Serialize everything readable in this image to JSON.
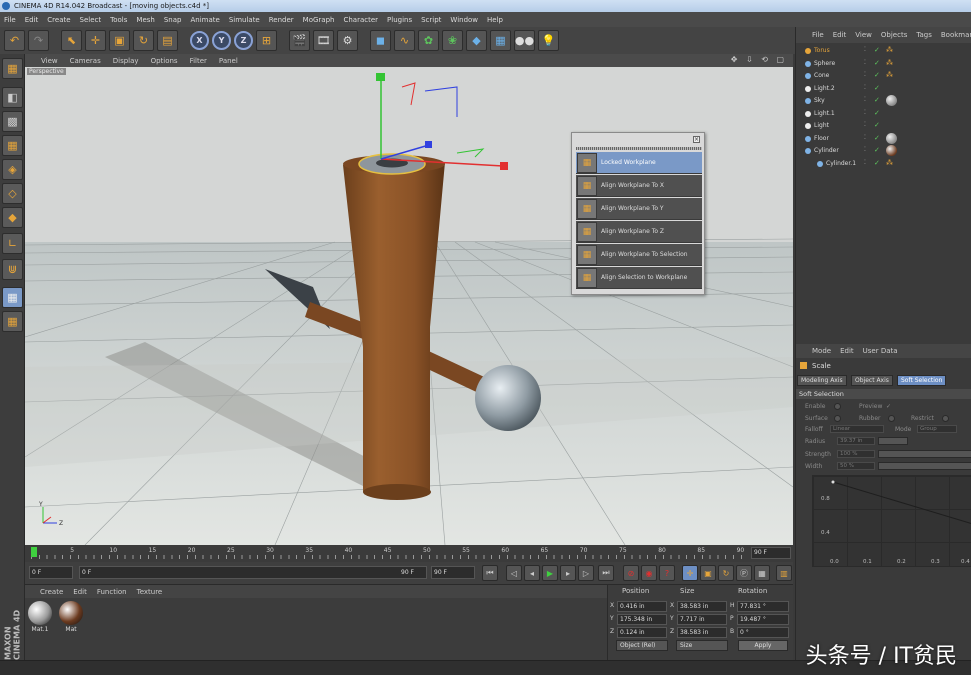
{
  "window": {
    "title": "CINEMA 4D R14.042 Broadcast - [moving objects.c4d *]"
  },
  "menu": [
    "File",
    "Edit",
    "Create",
    "Select",
    "Tools",
    "Mesh",
    "Snap",
    "Animate",
    "Simulate",
    "Render",
    "MoGraph",
    "Character",
    "Plugins",
    "Script",
    "Window",
    "Help"
  ],
  "toolbar": {
    "icons": [
      "undo-icon",
      "redo-icon",
      "live-select-icon",
      "move-icon",
      "scale-icon",
      "rotate-icon",
      "recent-tool-icon",
      "x-axis-lock",
      "y-axis-lock",
      "z-axis-lock",
      "world-coord-icon",
      "render-view-icon",
      "render-picture-viewer-icon",
      "edit-render-settings-icon",
      "cube-primitive-icon",
      "spline-pen-icon",
      "nurbs-icon",
      "array-icon",
      "deformer-icon",
      "floor-icon",
      "camera-icon",
      "light-icon"
    ],
    "axis_labels": {
      "x": "X",
      "y": "Y",
      "z": "Z"
    }
  },
  "viewport": {
    "menu": [
      "View",
      "Cameras",
      "Display",
      "Options",
      "Filter",
      "Panel"
    ],
    "camera_label": "Perspective",
    "nav_icons": "✥ ⇩ ⟲ ▢"
  },
  "workplane_popup": {
    "items": [
      {
        "label": "Locked Workplane",
        "active": true
      },
      {
        "label": "Align Workplane To X",
        "active": false
      },
      {
        "label": "Align Workplane To Y",
        "active": false
      },
      {
        "label": "Align Workplane To Z",
        "active": false
      },
      {
        "label": "Align Workplane To Selection",
        "active": false
      },
      {
        "label": "Align Selection to Workplane",
        "active": false
      }
    ]
  },
  "timeline": {
    "ticks": [
      "0",
      "5",
      "10",
      "15",
      "20",
      "25",
      "30",
      "35",
      "40",
      "45",
      "50",
      "55",
      "60",
      "65",
      "70",
      "75",
      "80",
      "85",
      "90"
    ],
    "end_frame": "90 F"
  },
  "transport": {
    "current_frame": "0 F",
    "range_start": "0 F",
    "range_end_inline": "90 F",
    "max_frame": "90 F"
  },
  "materials": {
    "menu": [
      "Create",
      "Edit",
      "Function",
      "Texture"
    ],
    "items": [
      {
        "name": "Mat.1",
        "color": "#9a9a9a"
      },
      {
        "name": "Mat",
        "color": "#6b3a1f"
      }
    ]
  },
  "branding": {
    "maxon": "MAXON CINEMA 4D"
  },
  "coordinates": {
    "headers": {
      "position": "Position",
      "size": "Size",
      "rotation": "Rotation"
    },
    "rows": [
      {
        "axis": "X",
        "position": "0.416 in",
        "size_axis": "X",
        "size": "38.583 in",
        "rot_axis": "H",
        "rotation": "77.831 °"
      },
      {
        "axis": "Y",
        "position": "175.348 in",
        "size_axis": "Y",
        "size": "7.717 in",
        "rot_axis": "P",
        "rotation": "19.487 °"
      },
      {
        "axis": "Z",
        "position": "0.124 in",
        "size_axis": "Z",
        "size": "38.583 in",
        "rot_axis": "B",
        "rotation": "0 °"
      }
    ],
    "mode_select": "Object (Rel)",
    "size_select": "Size",
    "apply_label": "Apply"
  },
  "object_manager": {
    "menu": [
      "File",
      "Edit",
      "View",
      "Objects",
      "Tags",
      "Bookmarks"
    ],
    "objects": [
      {
        "name": "Torus",
        "indent": 0,
        "color": "#e6a53a",
        "icon": "torus-icon",
        "highlight": true,
        "tag": "phong"
      },
      {
        "name": "Sphere",
        "indent": 0,
        "color": "#7fb3e6",
        "icon": "sphere-icon",
        "highlight": false,
        "tag": "phong"
      },
      {
        "name": "Cone",
        "indent": 0,
        "color": "#7fb3e6",
        "icon": "cone-icon",
        "highlight": false,
        "tag": "phong"
      },
      {
        "name": "Light.2",
        "indent": 0,
        "color": "#eeeeee",
        "icon": "light-icon",
        "highlight": false,
        "tag": ""
      },
      {
        "name": "Sky",
        "indent": 0,
        "color": "#7fb3e6",
        "icon": "sky-icon",
        "highlight": false,
        "tag": "material"
      },
      {
        "name": "Light.1",
        "indent": 0,
        "color": "#eeeeee",
        "icon": "light-icon",
        "highlight": false,
        "tag": ""
      },
      {
        "name": "Light",
        "indent": 0,
        "color": "#eeeeee",
        "icon": "light-icon",
        "highlight": false,
        "tag": ""
      },
      {
        "name": "Floor",
        "indent": 0,
        "color": "#7fb3e6",
        "icon": "floor-icon",
        "highlight": false,
        "tag": "material"
      },
      {
        "name": "Cylinder",
        "indent": 0,
        "color": "#7fb3e6",
        "icon": "cylinder-icon",
        "highlight": false,
        "tag": "material-brown"
      },
      {
        "name": "Cylinder.1",
        "indent": 1,
        "color": "#7fb3e6",
        "icon": "cylinder-icon",
        "highlight": false,
        "tag": "phong"
      }
    ]
  },
  "attribute_manager": {
    "menu": [
      "Mode",
      "Edit",
      "User Data"
    ],
    "tool_name": "Scale",
    "tabs": [
      {
        "label": "Modeling Axis",
        "active": false
      },
      {
        "label": "Object Axis",
        "active": false
      },
      {
        "label": "Soft Selection",
        "active": true
      }
    ],
    "section_title": "Soft Selection",
    "enable_label": "Enable",
    "preview_label": "Preview",
    "preview_check": "✓",
    "surface_label": "Surface",
    "rubber_label": "Rubber",
    "restrict_label": "Restrict",
    "falloff_label": "Falloff",
    "falloff_value": "Linear",
    "mode_label": "Mode",
    "mode_value": "Group",
    "radius_label": "Radius",
    "radius_value": "39.37 in",
    "strength_label": "Strength",
    "strength_value": "100 %",
    "width_label": "Width",
    "width_value": "50 %",
    "graph_y": [
      "0.8",
      "0.4"
    ],
    "graph_x": [
      "0.0",
      "0.1",
      "0.2",
      "0.3",
      "0.4"
    ]
  },
  "watermark": "头条号 / IT贫民"
}
